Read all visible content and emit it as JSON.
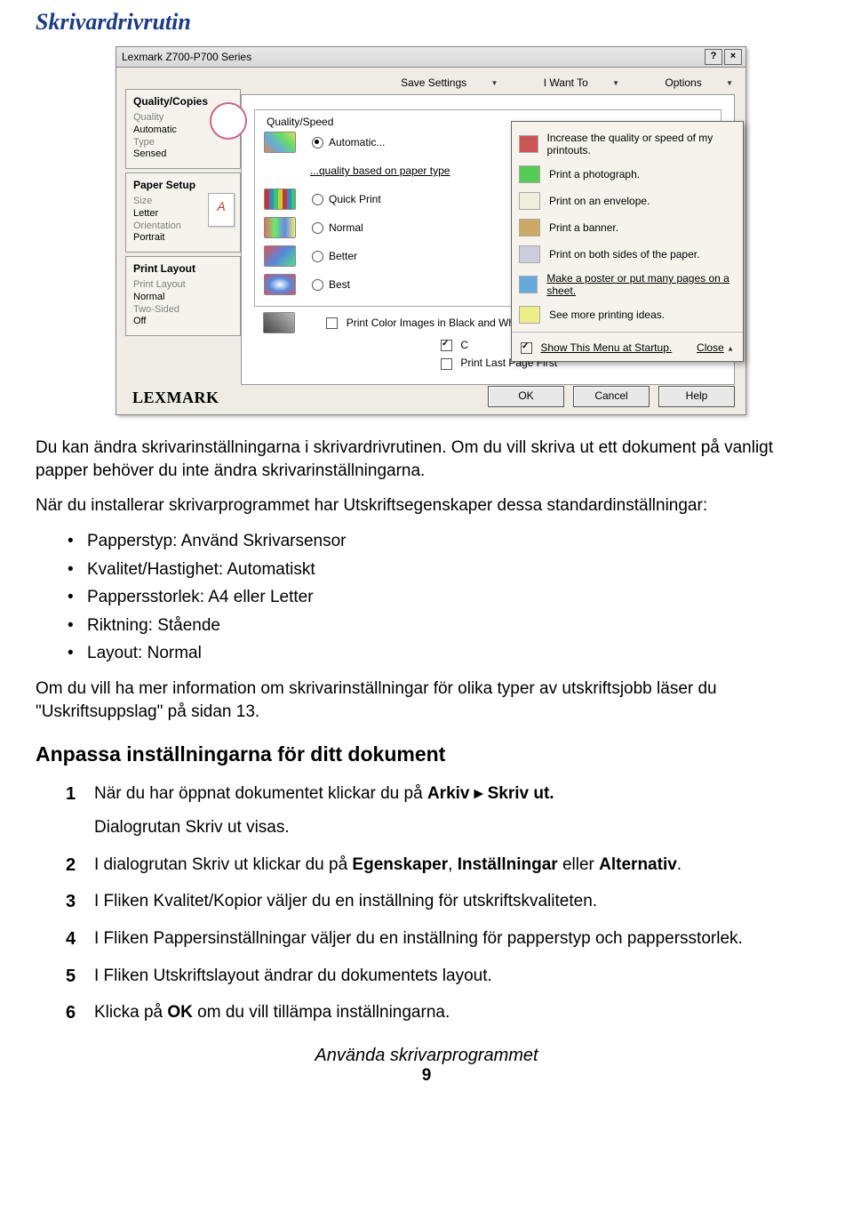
{
  "section_title": "Skrivardrivrutin",
  "dialog": {
    "title": "Lexmark Z700-P700 Series",
    "title_btns": {
      "help": "?",
      "close": "×"
    },
    "menus": {
      "save": "Save Settings",
      "iwantto": "I Want To",
      "options": "Options"
    },
    "tabs": {
      "qc": {
        "title": "Quality/Copies",
        "l1": "Quality",
        "v1": "Automatic",
        "l2": "Type",
        "v2": "Sensed"
      },
      "ps": {
        "title": "Paper Setup",
        "l1": "Size",
        "v1": "Letter",
        "l2": "Orientation",
        "v2": "Portrait"
      },
      "pl": {
        "title": "Print Layout",
        "l1": "Print Layout",
        "v1": "Normal",
        "l2": "Two-Sided",
        "v2": "Off"
      }
    },
    "qs": {
      "legend": "Quality/Speed",
      "items": {
        "automatic": "Automatic...",
        "quality_based": "...quality based on paper type",
        "quick": "Quick Print",
        "normal": "Normal",
        "better": "Better",
        "best": "Best"
      }
    },
    "chk": {
      "bw": "Print Color Images in Black and White",
      "ci": "C",
      "last": "Print Last Page First"
    },
    "overlay": {
      "items": {
        "inc": "Increase the quality or speed of my printouts.",
        "photo": "Print a photograph.",
        "env": "Print on an envelope.",
        "banner": "Print a banner.",
        "both": "Print on both sides of the paper.",
        "poster": "Make a poster or put many pages on a sheet.",
        "more": "See more printing ideas."
      },
      "startup": "Show This Menu at Startup.",
      "close": "Close"
    },
    "btns": {
      "ok": "OK",
      "cancel": "Cancel",
      "help": "Help"
    },
    "logo": "LEXMARK"
  },
  "text": {
    "p1": "Du kan ändra skrivarinställningarna i skrivardrivrutinen. Om du vill skriva ut ett dokument på vanligt papper behöver du inte ändra skrivarinställningarna.",
    "p2": "När du installerar skrivarprogrammet har Utskriftsegenskaper dessa standardinställningar:",
    "bullets": {
      "b0": "Papperstyp: Använd Skrivarsensor",
      "b1": "Kvalitet/Hastighet: Automatiskt",
      "b2": "Pappersstorlek: A4 eller Letter",
      "b3": "Riktning: Stående",
      "b4": "Layout: Normal"
    },
    "p3": "Om du vill ha mer information om skrivarinställningar för olika typer av utskriftsjobb läser du \"Uskriftsuppslag\" på sidan 13.",
    "subheading": "Anpassa inställningarna för ditt dokument",
    "steps": {
      "s1a": "När du har öppnat dokumentet klickar du på ",
      "s1_arkiv": "Arkiv",
      "s1_arrow": " ▸ ",
      "s1_skriv": "Skriv ut.",
      "s1b": "Dialogrutan Skriv ut visas.",
      "s2a": "I dialogrutan Skriv ut klickar du på ",
      "s2_eg": "Egenskaper",
      "s2_comma": ", ",
      "s2_inst": "Inställningar",
      "s2_eller": " eller ",
      "s2_alt": "Alternativ",
      "s2_dot": ".",
      "s3": "I Fliken Kvalitet/Kopior väljer du en inställning för utskriftskvaliteten.",
      "s4": "I Fliken Pappersinställningar väljer du en inställning för papperstyp och pappersstorlek.",
      "s5": "I Fliken Utskriftslayout ändrar du dokumentets layout.",
      "s6a": "Klicka på ",
      "s6_ok": "OK",
      "s6b": " om du vill tillämpa inställningarna."
    }
  },
  "footer": {
    "text": "Använda skrivarprogrammet",
    "page": "9"
  }
}
